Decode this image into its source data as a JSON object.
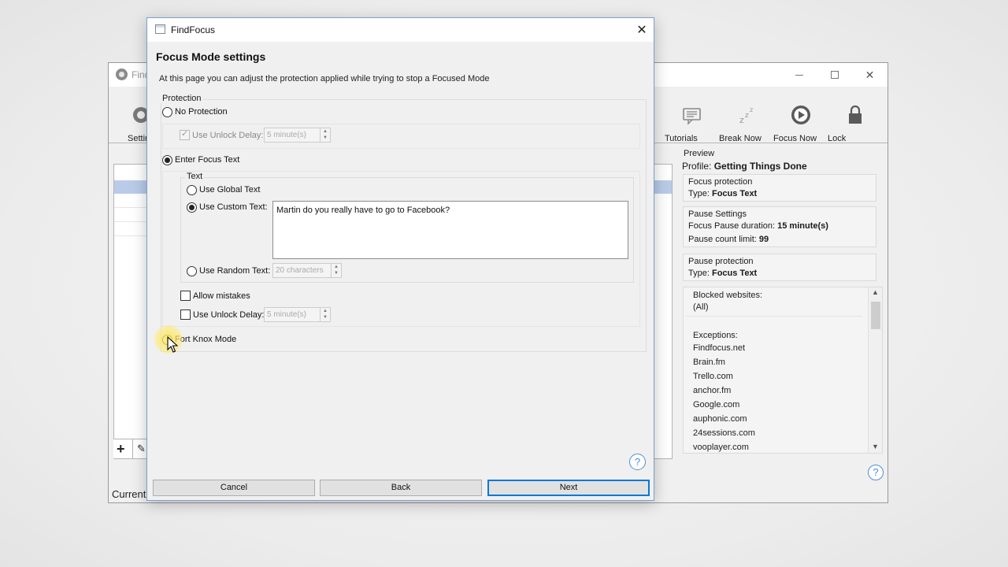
{
  "main_window": {
    "title": "Find",
    "toolbar": {
      "settings_label": "Settin",
      "tutorials_label": "Tutorials",
      "break_now_label": "Break Now",
      "focus_now_label": "Focus Now",
      "lock_label": "Lock"
    },
    "status": "Current",
    "preview": {
      "title": "Preview",
      "profile_prefix": "Profile: ",
      "profile_name": "Getting Things Done",
      "focus_protection": {
        "header": "Focus protection",
        "type_prefix": "Type: ",
        "type_value": "Focus Text"
      },
      "pause_settings": {
        "header": "Pause Settings",
        "duration_prefix": "Focus Pause duration: ",
        "duration_value": "15 minute(s)",
        "limit_prefix": "Pause count limit: ",
        "limit_value": "99"
      },
      "pause_protection": {
        "header": "Pause protection",
        "type_prefix": "Type: ",
        "type_value": "Focus Text"
      },
      "blocked_header": "Blocked websites:",
      "blocked_value": "(All)",
      "exceptions_header": "Exceptions:",
      "exceptions": [
        "Findfocus.net",
        "Brain.fm",
        "Trello.com",
        "anchor.fm",
        "Google.com",
        "auphonic.com",
        "24sessions.com",
        "vooplayer.com"
      ]
    },
    "help": "?"
  },
  "dialog": {
    "title": "FindFocus",
    "heading": "Focus Mode settings",
    "subtitle": "At this page you can adjust the protection applied while trying to stop a Focused Mode",
    "protection_group": "Protection",
    "no_protection": "No Protection",
    "use_unlock_delay_1": "Use Unlock Delay:",
    "unlock_delay_1_value": "5 minute(s)",
    "enter_focus_text": "Enter Focus Text",
    "text_group": "Text",
    "use_global_text": "Use Global Text",
    "use_custom_text": "Use Custom Text:",
    "custom_text_value": "Martin do you really have to go to Facebook?",
    "use_random_text": "Use Random Text:",
    "random_text_value": "20 characters",
    "allow_mistakes": "Allow mistakes",
    "use_unlock_delay_2": "Use Unlock Delay:",
    "unlock_delay_2_value": "5 minute(s)",
    "fort_knox_mode": "Fort Knox Mode",
    "help": "?",
    "buttons": {
      "cancel": "Cancel",
      "back": "Back",
      "next": "Next"
    }
  },
  "colors": {
    "accent": "#0078d7",
    "help_blue": "#4a90d9",
    "highlight_row": "#b9cbe8"
  }
}
